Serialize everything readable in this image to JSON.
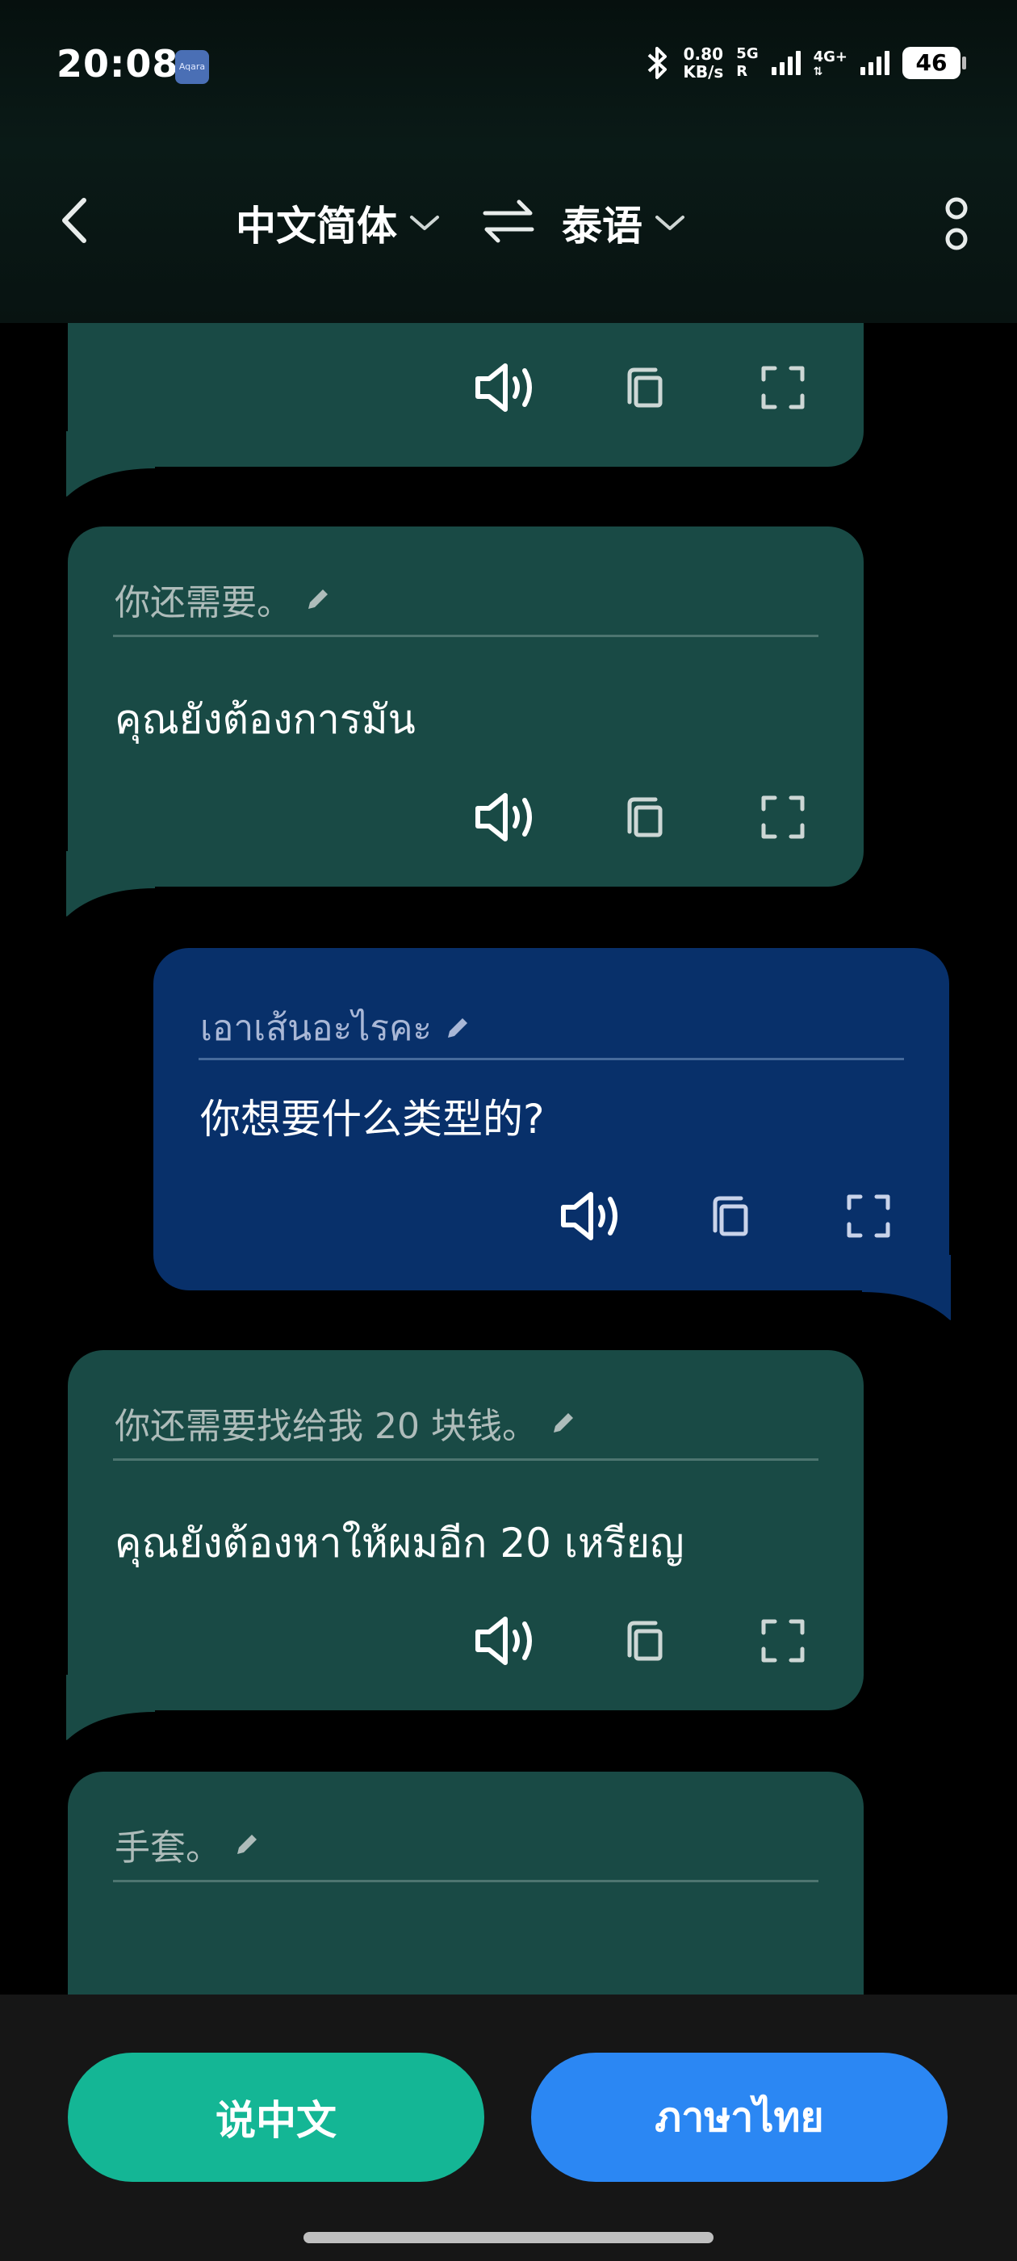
{
  "status_bar": {
    "time": "20:08",
    "app_badge": "Aqara",
    "net_speed_value": "0.80",
    "net_speed_unit": "KB/s",
    "sim1_label": "5G",
    "sim1_sub": "R",
    "sim2_label": "4G+",
    "battery": "46"
  },
  "header": {
    "source_language": "中文简体",
    "target_language": "泰语",
    "icons": [
      "back-arrow",
      "chevron-down",
      "swap-arrows",
      "chevron-down",
      "more-vertical"
    ]
  },
  "conversation": [
    {
      "side": "left",
      "color": "#194a45",
      "source_text": "",
      "translated_text": "",
      "partial": true
    },
    {
      "side": "left",
      "color": "#194a45",
      "source_text": "你还需要。",
      "translated_text": "คุณยังต้องการมัน"
    },
    {
      "side": "right",
      "color": "#08306a",
      "source_text": "เอาเส้นอะไรคะ",
      "translated_text": "你想要什么类型的?"
    },
    {
      "side": "left",
      "color": "#194a45",
      "source_text": "你还需要找给我 20 块钱。",
      "translated_text": "คุณยังต้องหาให้ผมอีก 20 เหรียญ"
    },
    {
      "side": "left",
      "color": "#194a45",
      "source_text": "手套。",
      "translated_text": "",
      "partial": true
    }
  ],
  "bubble_actions": [
    "speaker-icon",
    "copy-icon",
    "fullscreen-icon"
  ],
  "bottom_bar": {
    "speak_chinese_label": "说中文",
    "speak_thai_label": "ภาษาไทย",
    "speak_chinese_color": "#14b695",
    "speak_thai_color": "#2b87f3"
  }
}
